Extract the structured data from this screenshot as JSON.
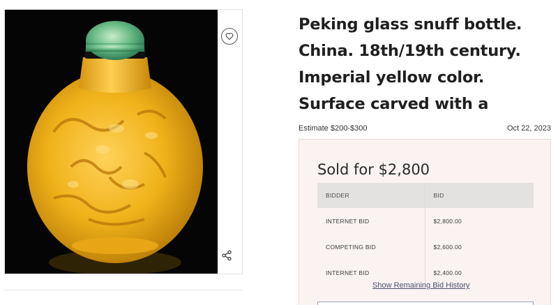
{
  "lot": {
    "title": "Peking glass snuff bottle. China. 18th/19th century. Imperial yellow color. Surface carved with a",
    "estimate": "Estimate $200-$300",
    "date": "Oct 22, 2023"
  },
  "icons": {
    "favorite": "heart-icon",
    "share": "share-icon"
  },
  "sold": {
    "heading": "Sold for $2,800",
    "table": {
      "headers": [
        "BIDDER",
        "BID"
      ],
      "rows": [
        {
          "bidder": "INTERNET BID",
          "bid": "$2,800.00"
        },
        {
          "bidder": "COMPETING BID",
          "bid": "$2,600.00"
        },
        {
          "bidder": "INTERNET BID",
          "bid": "$2,400.00"
        }
      ]
    },
    "more_link": "Show Remaining Bid History"
  },
  "colors": {
    "panel_bg": "#fbf2f2",
    "table_header_bg": "#e4e1e1",
    "link": "#4a5470",
    "bottle_yellow": "#f0b21a",
    "stopper_jade": "#6fbf8a"
  }
}
